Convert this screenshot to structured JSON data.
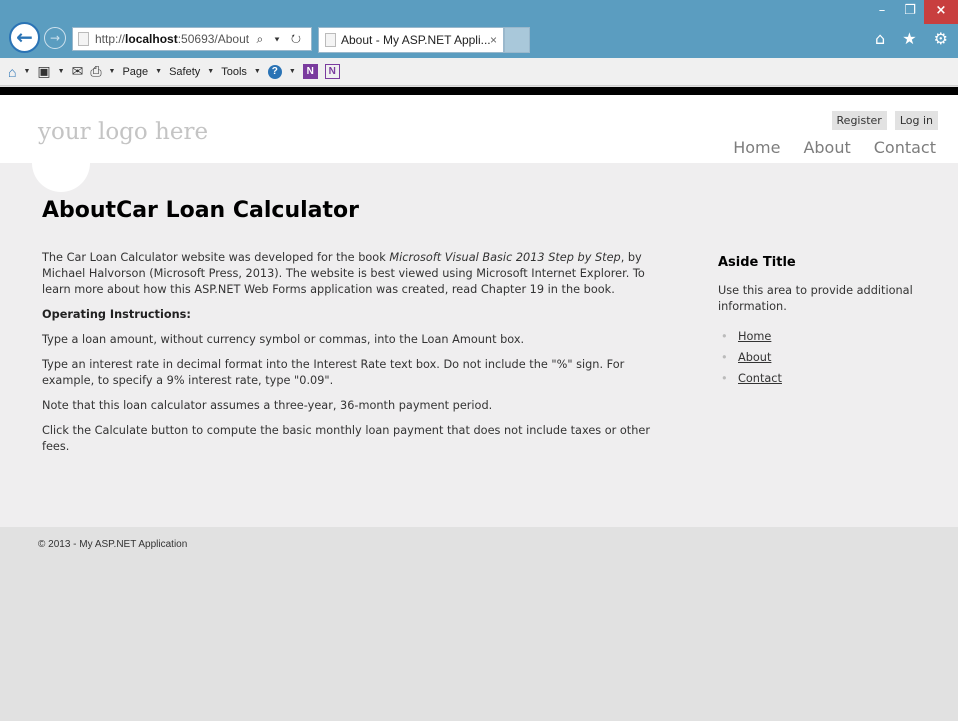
{
  "browser": {
    "address_url_prefix": "http://",
    "address_url_host": "localhost",
    "address_url_rest": ":50693/About",
    "address_icons": "⌕ ▾ ↻",
    "tab_title": "About - My ASP.NET Appli...",
    "tab_close": "×",
    "window_minimize": "–",
    "window_restore": "❐",
    "window_close": "×",
    "right_icons": "⌂ ★ ⚙",
    "back_glyph": "←",
    "forward_glyph": "→"
  },
  "command_bar": {
    "page_label": "Page",
    "safety_label": "Safety",
    "tools_label": "Tools",
    "help_glyph": "?",
    "onenote_glyph": "N",
    "caret": "▼"
  },
  "site": {
    "logo_text": "your logo here",
    "register_label": "Register",
    "login_label": "Log in",
    "nav": [
      "Home",
      "About",
      "Contact"
    ]
  },
  "page": {
    "title": "AboutCar Loan Calculator",
    "intro_pre": "The Car Loan Calculator website was developed for the book ",
    "intro_book": "Microsoft Visual Basic 2013 Step by Step",
    "intro_post": ", by Michael Halvorson (Microsoft Press, 2013). The website is best viewed using Microsoft Internet Explorer. To learn more about how this ASP.NET Web Forms application was created, read Chapter 19 in the book.",
    "instructions_heading": "Operating Instructions:",
    "step1": "Type a loan amount, without currency symbol or commas, into the Loan Amount box.",
    "step2": "Type an interest rate in decimal format into the Interest Rate text box. Do not include the \"%\" sign. For example, to specify a 9% interest rate, type \"0.09\".",
    "step3": "Note that this loan calculator assumes a three-year, 36-month payment period.",
    "step4": "Click the Calculate button to compute the basic monthly loan payment that does not include taxes or other fees."
  },
  "aside": {
    "title": "Aside Title",
    "text": "Use this area to provide additional information.",
    "links": [
      "Home",
      "About",
      "Contact"
    ]
  },
  "footer": {
    "copyright": "© 2013 - My ASP.NET Application"
  }
}
